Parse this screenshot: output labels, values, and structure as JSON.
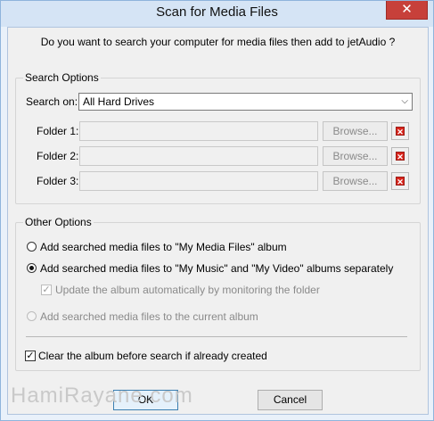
{
  "window": {
    "title": "Scan for Media Files",
    "close_glyph": "✕"
  },
  "question": "Do you want to search your computer for media files then add to jetAudio ?",
  "search_options": {
    "group_label": "Search Options",
    "search_on_label": "Search on:",
    "search_on_value": "All Hard Drives",
    "folders": [
      {
        "label": "Folder 1:",
        "value": "",
        "browse": "Browse..."
      },
      {
        "label": "Folder 2:",
        "value": "",
        "browse": "Browse..."
      },
      {
        "label": "Folder 3:",
        "value": "",
        "browse": "Browse..."
      }
    ],
    "delete_icon": "x-icon"
  },
  "other_options": {
    "group_label": "Other Options",
    "radio_1": "Add searched media files to \"My Media Files\" album",
    "radio_2": "Add searched media files to \"My Music\" and \"My Video\" albums separately",
    "sub_check": "Update the album automatically by monitoring the folder",
    "radio_3": "Add searched media files to the current album",
    "selected_radio": "radio_2",
    "sub_check_checked": true
  },
  "clear_album": {
    "label": "Clear the album before search if already created",
    "checked": true
  },
  "buttons": {
    "ok": "OK",
    "cancel": "Cancel"
  },
  "watermark": "HamiRayane.com",
  "colors": {
    "title_bar": "#d5e4f5",
    "close_button": "#c7403a",
    "delete_icon": "#d9251c"
  }
}
